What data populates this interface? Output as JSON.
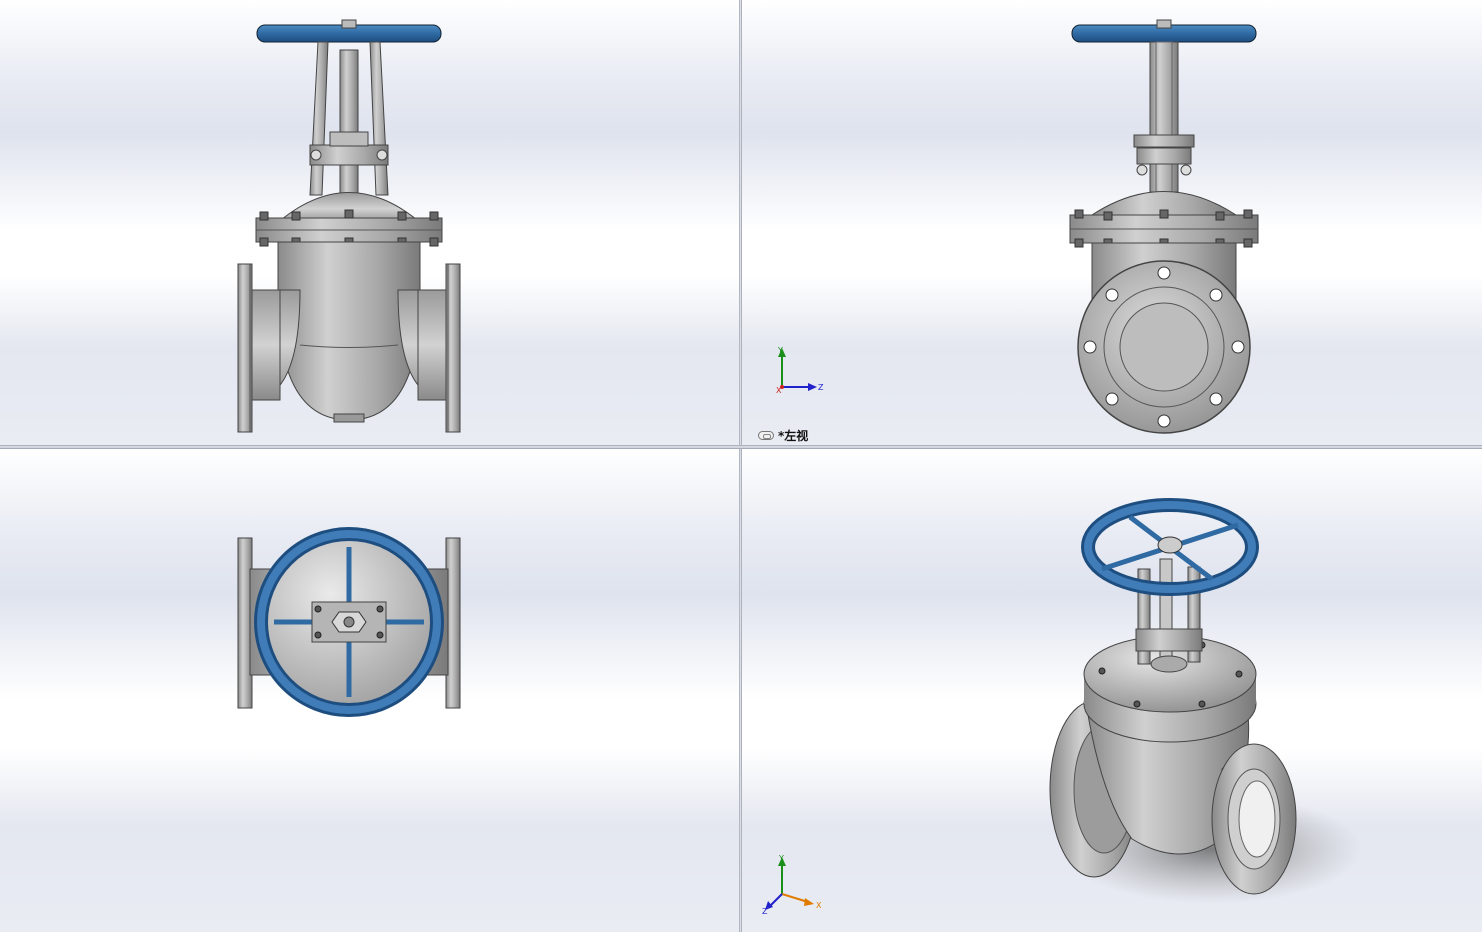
{
  "viewports": {
    "front": {},
    "left": {
      "label": "*左视",
      "link_icon": "link-view-icon"
    },
    "top": {},
    "iso": {}
  },
  "triads": {
    "left_view": {
      "axis_y": "Y",
      "axis_z": "Z",
      "axis_x": "X"
    },
    "iso_view": {
      "axis_y": "Y",
      "axis_z": "Z",
      "axis_x": "X"
    }
  },
  "colors": {
    "handwheel": "#2f6aa3",
    "steel": "#a9a9a9",
    "steel_dark": "#6f6f6f",
    "axis_y": "#1a8f1a",
    "axis_z": "#2222cc",
    "axis_x": "#e07b00",
    "axis_red": "#cc2222"
  }
}
